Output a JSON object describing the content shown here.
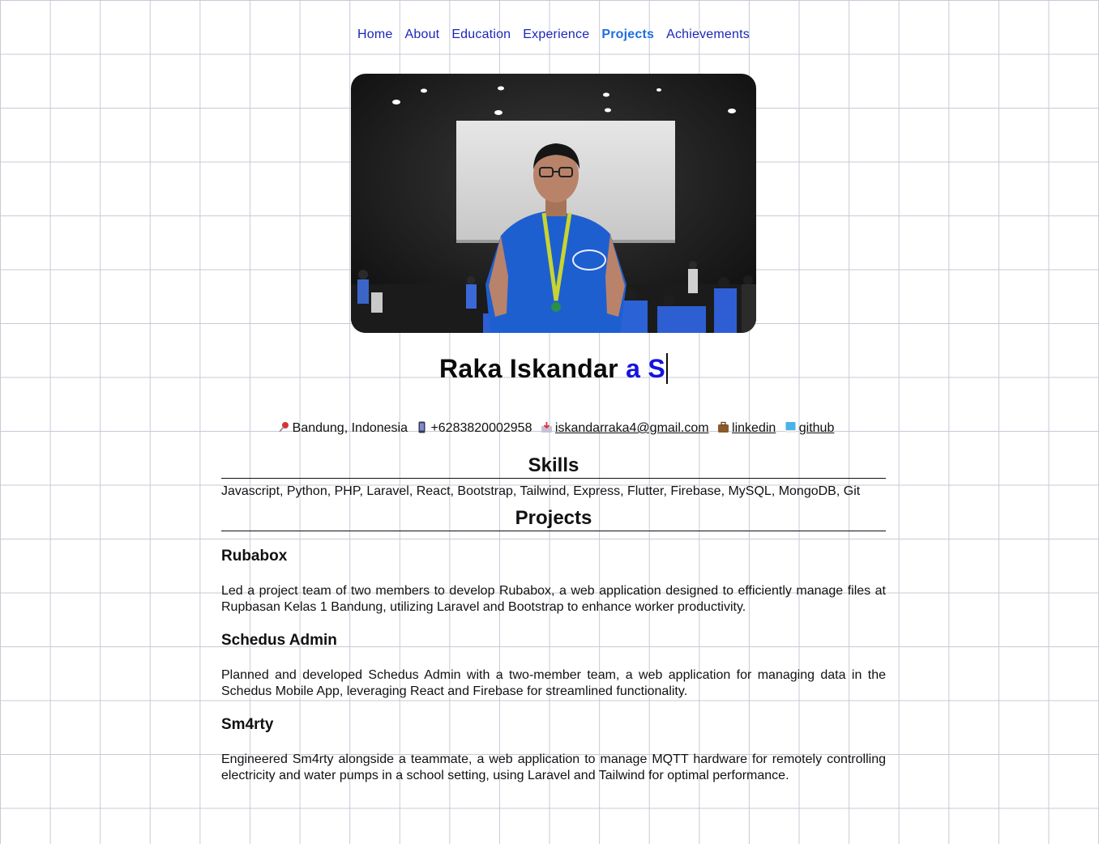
{
  "nav": {
    "items": [
      {
        "label": "Home"
      },
      {
        "label": "About"
      },
      {
        "label": "Education"
      },
      {
        "label": "Experience"
      },
      {
        "label": "Projects",
        "active": true
      },
      {
        "label": "Achievements"
      }
    ]
  },
  "profile": {
    "name": "Raka Iskandar",
    "typed_text": "a S"
  },
  "contacts": {
    "location": "Bandung, Indonesia",
    "phone": "+6283820002958",
    "email": "iskandarraka4@gmail.com",
    "linkedin": "linkedin",
    "github": "github"
  },
  "skills": {
    "title": "Skills",
    "text": "Javascript, Python, PHP, Laravel, React, Bootstrap, Tailwind, Express, Flutter, Firebase, MySQL, MongoDB, Git"
  },
  "projects": {
    "title": "Projects",
    "items": [
      {
        "name": "Rubabox",
        "description": "Led a project team of two members to develop Rubabox, a web application designed to efficiently manage files at Rupbasan Kelas 1 Bandung, utilizing Laravel and Bootstrap to enhance worker productivity."
      },
      {
        "name": "Schedus Admin",
        "description": "Planned and developed Schedus Admin with a two-member team, a web application for managing data in the Schedus Mobile App, leveraging React and Firebase for streamlined functionality."
      },
      {
        "name": "Sm4rty",
        "description": "Engineered Sm4rty alongside a teammate, a web application to manage MQTT hardware for remotely controlling electricity and water pumps in a school setting, using Laravel and Tailwind for optimal performance."
      }
    ]
  },
  "colors": {
    "nav_link": "#1a27b8",
    "nav_active": "#1f6ee0",
    "typed_accent": "#1414e0",
    "shirt_blue": "#1e5fd0",
    "grid_line": "#c9c9d6"
  }
}
